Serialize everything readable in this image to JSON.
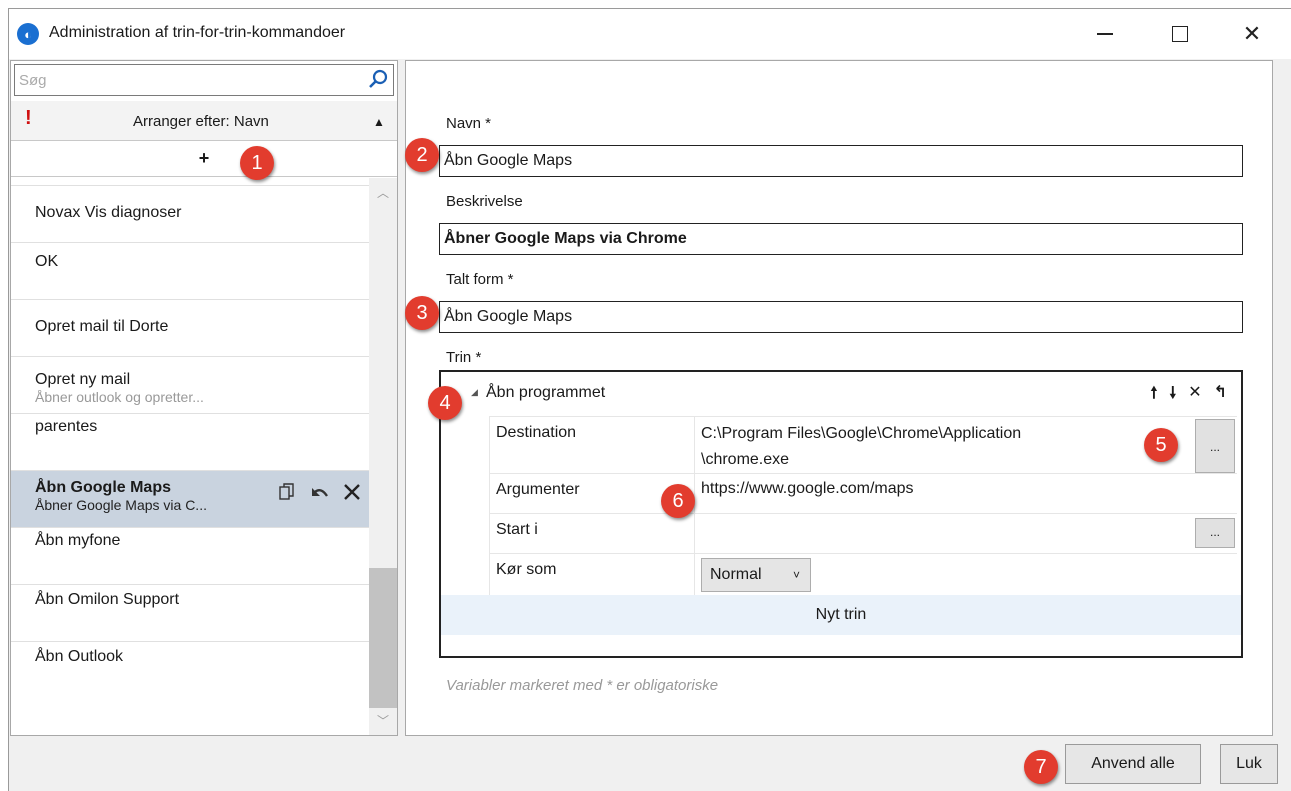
{
  "window": {
    "title": "Administration af trin-for-trin-kommandoer",
    "minimize": "",
    "maximize": "",
    "close": "✕"
  },
  "sidebar": {
    "search_placeholder": "Søg",
    "sort_warning": "!",
    "sort_label": "Arranger efter: Navn",
    "sort_arrow": "▲",
    "add_label": "+",
    "items": [
      {
        "name": "Novax Vis diagnoser",
        "desc": ""
      },
      {
        "name": "OK",
        "desc": ""
      },
      {
        "name": "Opret mail til Dorte",
        "desc": ""
      },
      {
        "name": "Opret ny mail",
        "desc": "Åbner outlook og opretter..."
      },
      {
        "name": "parentes",
        "desc": ""
      },
      {
        "name": "Åbn Google Maps",
        "desc": "Åbner Google Maps via C..."
      },
      {
        "name": "Åbn myfone",
        "desc": ""
      },
      {
        "name": "Åbn Omilon Support",
        "desc": ""
      },
      {
        "name": "Åbn Outlook",
        "desc": ""
      }
    ],
    "scroll_up": "︿",
    "scroll_down": "﹀"
  },
  "form": {
    "name_label": "Navn *",
    "name_value": "Åbn Google Maps",
    "desc_label": "Beskrivelse",
    "desc_value": "Åbner Google Maps via Chrome",
    "spoken_label": "Talt form *",
    "spoken_value": "Åbn Google Maps",
    "steps_label": "Trin *",
    "step": {
      "toggle": "◢",
      "title": "Åbn programmet",
      "actions": {
        "up": "🠕",
        "down": "🠗",
        "delete": "✕",
        "back": "↰"
      },
      "rows": [
        {
          "label": "Destination",
          "value_line1": "C:\\Program Files\\Google\\Chrome\\Application",
          "value_line2": "\\chrome.exe"
        },
        {
          "label": "Argumenter",
          "value": "https://www.google.com/maps"
        },
        {
          "label": "Start i",
          "value": ""
        },
        {
          "label": "Kør som",
          "value": "Normal"
        }
      ],
      "browse": "...",
      "combo_chevron": "˅"
    },
    "new_step": "Nyt trin",
    "hint": "Variabler markeret med * er obligatoriske"
  },
  "footer": {
    "apply_all": "Anvend alle",
    "close": "Luk"
  },
  "badges": [
    "1",
    "2",
    "3",
    "4",
    "5",
    "6",
    "7"
  ],
  "colors": {
    "badge": "#e23c2e",
    "selected_row": "#c9d3df",
    "new_step_bg": "#eaf2fa",
    "app_icon": "#1a6fd1"
  }
}
